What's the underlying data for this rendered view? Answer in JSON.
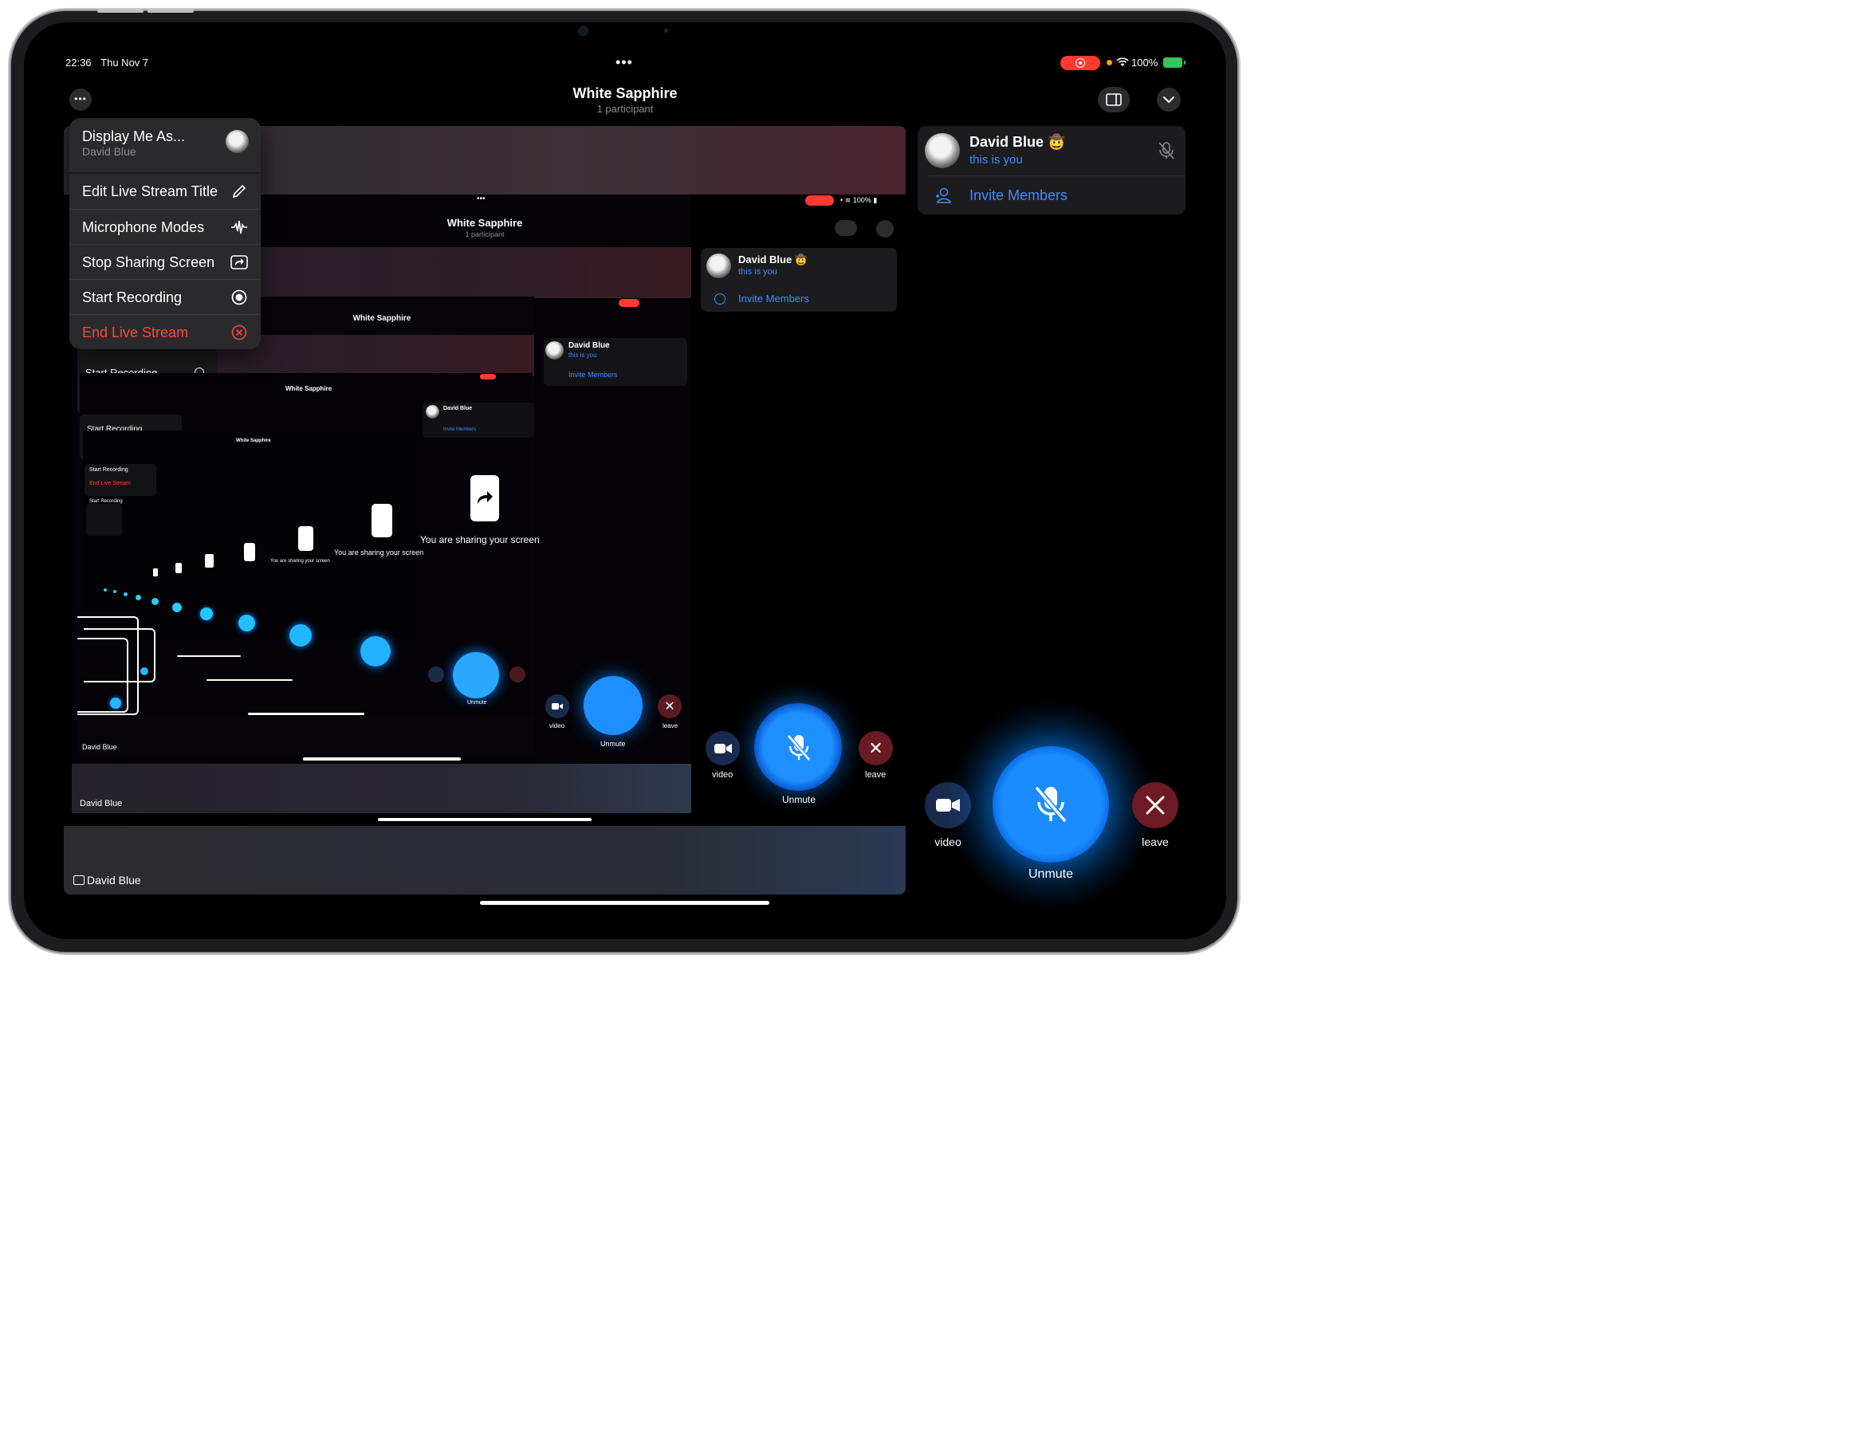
{
  "status": {
    "time": "22:36",
    "date": "Thu Nov 7",
    "battery": "100%"
  },
  "header": {
    "title": "White Sapphire",
    "subtitle": "1 participant"
  },
  "menu": {
    "display": {
      "label": "Display Me As...",
      "sub": "David Blue"
    },
    "items": [
      {
        "label": "Edit Live Stream Title",
        "icon": "pencil-icon"
      },
      {
        "label": "Microphone Modes",
        "icon": "waveform-icon"
      },
      {
        "label": "Stop Sharing Screen",
        "icon": "share-screen-icon"
      },
      {
        "label": "Start Recording",
        "icon": "record-icon"
      },
      {
        "label": "End Live Stream",
        "icon": "x-circle-icon"
      }
    ]
  },
  "participant": {
    "name": "David Blue",
    "emoji": "🤠",
    "sub": "this is you"
  },
  "invite_label": "Invite Members",
  "controls": {
    "video": "video",
    "unmute": "Unmute",
    "leave": "leave"
  },
  "stage_label": "David Blue",
  "sharing_text": "You are sharing your screen",
  "colors": {
    "accent": "#0a84ff",
    "danger": "#ff453a",
    "record": "#ff3b30"
  }
}
